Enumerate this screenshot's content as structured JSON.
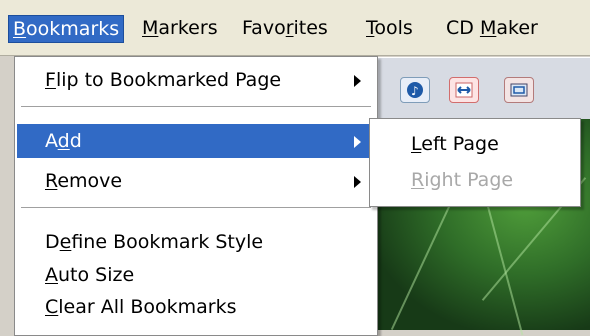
{
  "menubar": {
    "items": [
      {
        "label": "Bookmarks"
      },
      {
        "label": "Markers"
      },
      {
        "label": "Favorites"
      },
      {
        "label": "Tools"
      },
      {
        "label": "CD Maker"
      }
    ]
  },
  "dropdown": {
    "items": [
      {
        "label": "Flip to Bookmarked Page",
        "submenu": true
      },
      {
        "label": "Add",
        "submenu": true,
        "highlighted": true
      },
      {
        "label": "Remove",
        "submenu": true
      },
      {
        "label": "Define Bookmark Style"
      },
      {
        "label": "Auto Size"
      },
      {
        "label": "Clear All Bookmarks"
      }
    ]
  },
  "submenu": {
    "items": [
      {
        "label": "Left Page",
        "enabled": true
      },
      {
        "label": "Right Page",
        "enabled": false
      }
    ]
  },
  "toolbar": {
    "icons": [
      "music-note-icon",
      "fit-width-icon",
      "fit-page-icon"
    ]
  },
  "colors": {
    "highlight": "#316ac5",
    "menubar_bg": "#ece9d8",
    "disabled_text": "#a8a8a8"
  }
}
